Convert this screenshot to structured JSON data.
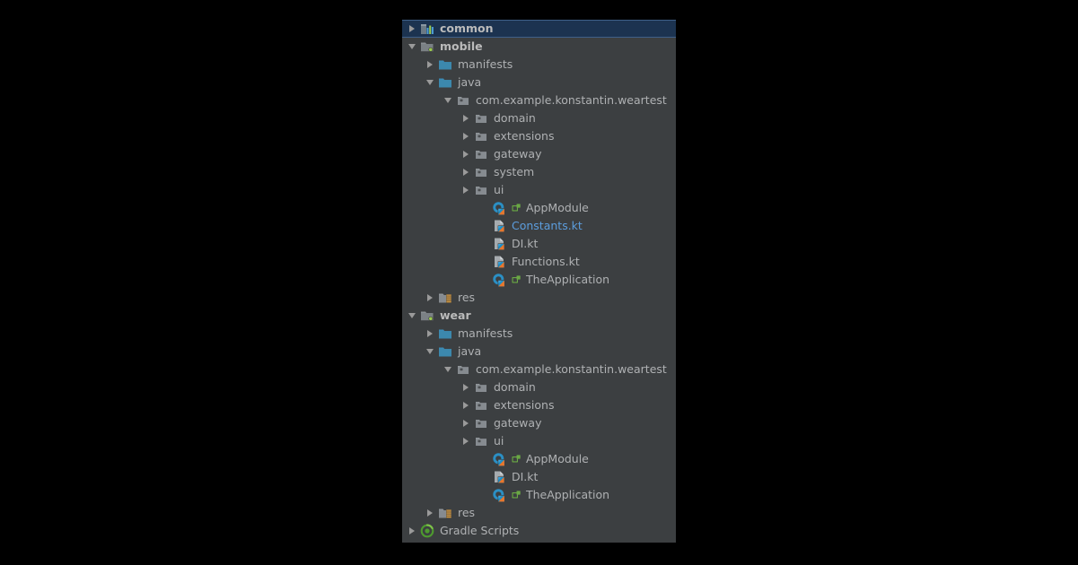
{
  "panel": {
    "name": "project-tree-panel",
    "background": "#3c3f41",
    "selection_color": "#1c3350",
    "selection_border": "#3f6089",
    "text_color": "#afb1b3",
    "link_color": "#5c9ddd"
  },
  "tree": [
    {
      "label": "common",
      "depth": 0,
      "arrow": "collapsed",
      "icon": "module-library-icon",
      "selected": true,
      "style": "bold"
    },
    {
      "label": "mobile",
      "depth": 0,
      "arrow": "expanded",
      "icon": "module-android-icon",
      "selected": false,
      "style": "bold"
    },
    {
      "label": "manifests",
      "depth": 1,
      "arrow": "collapsed",
      "icon": "folder-blue-icon",
      "selected": false,
      "style": "normal"
    },
    {
      "label": "java",
      "depth": 1,
      "arrow": "expanded",
      "icon": "folder-blue-icon",
      "selected": false,
      "style": "normal"
    },
    {
      "label": "com.example.konstantin.weartest",
      "depth": 2,
      "arrow": "expanded",
      "icon": "package-icon",
      "selected": false,
      "style": "normal"
    },
    {
      "label": "domain",
      "depth": 3,
      "arrow": "collapsed",
      "icon": "package-icon",
      "selected": false,
      "style": "normal"
    },
    {
      "label": "extensions",
      "depth": 3,
      "arrow": "collapsed",
      "icon": "package-icon",
      "selected": false,
      "style": "normal"
    },
    {
      "label": "gateway",
      "depth": 3,
      "arrow": "collapsed",
      "icon": "package-icon",
      "selected": false,
      "style": "normal"
    },
    {
      "label": "system",
      "depth": 3,
      "arrow": "collapsed",
      "icon": "package-icon",
      "selected": false,
      "style": "normal"
    },
    {
      "label": "ui",
      "depth": 3,
      "arrow": "collapsed",
      "icon": "package-icon",
      "selected": false,
      "style": "normal"
    },
    {
      "label": "AppModule",
      "depth": 4,
      "arrow": "none",
      "icon": "kotlin-class-icon",
      "badge": "class-badge-icon",
      "selected": false,
      "style": "normal"
    },
    {
      "label": "Constants.kt",
      "depth": 4,
      "arrow": "none",
      "icon": "kotlin-file-icon",
      "selected": false,
      "style": "blue"
    },
    {
      "label": "DI.kt",
      "depth": 4,
      "arrow": "none",
      "icon": "kotlin-file-icon",
      "selected": false,
      "style": "normal"
    },
    {
      "label": "Functions.kt",
      "depth": 4,
      "arrow": "none",
      "icon": "kotlin-file-icon",
      "selected": false,
      "style": "normal"
    },
    {
      "label": "TheApplication",
      "depth": 4,
      "arrow": "none",
      "icon": "kotlin-class-icon",
      "badge": "class-badge-icon",
      "selected": false,
      "style": "normal"
    },
    {
      "label": "res",
      "depth": 1,
      "arrow": "collapsed",
      "icon": "res-folder-icon",
      "selected": false,
      "style": "normal"
    },
    {
      "label": "wear",
      "depth": 0,
      "arrow": "expanded",
      "icon": "module-android-icon",
      "selected": false,
      "style": "bold"
    },
    {
      "label": "manifests",
      "depth": 1,
      "arrow": "collapsed",
      "icon": "folder-blue-icon",
      "selected": false,
      "style": "normal"
    },
    {
      "label": "java",
      "depth": 1,
      "arrow": "expanded",
      "icon": "folder-blue-icon",
      "selected": false,
      "style": "normal"
    },
    {
      "label": "com.example.konstantin.weartest",
      "depth": 2,
      "arrow": "expanded",
      "icon": "package-icon",
      "selected": false,
      "style": "normal"
    },
    {
      "label": "domain",
      "depth": 3,
      "arrow": "collapsed",
      "icon": "package-icon",
      "selected": false,
      "style": "normal"
    },
    {
      "label": "extensions",
      "depth": 3,
      "arrow": "collapsed",
      "icon": "package-icon",
      "selected": false,
      "style": "normal"
    },
    {
      "label": "gateway",
      "depth": 3,
      "arrow": "collapsed",
      "icon": "package-icon",
      "selected": false,
      "style": "normal"
    },
    {
      "label": "ui",
      "depth": 3,
      "arrow": "collapsed",
      "icon": "package-icon",
      "selected": false,
      "style": "normal"
    },
    {
      "label": "AppModule",
      "depth": 4,
      "arrow": "none",
      "icon": "kotlin-class-icon",
      "badge": "class-badge-icon",
      "selected": false,
      "style": "normal"
    },
    {
      "label": "DI.kt",
      "depth": 4,
      "arrow": "none",
      "icon": "kotlin-file-icon",
      "selected": false,
      "style": "normal"
    },
    {
      "label": "TheApplication",
      "depth": 4,
      "arrow": "none",
      "icon": "kotlin-class-icon",
      "badge": "class-badge-icon",
      "selected": false,
      "style": "normal"
    },
    {
      "label": "res",
      "depth": 1,
      "arrow": "collapsed",
      "icon": "res-folder-icon",
      "selected": false,
      "style": "normal"
    },
    {
      "label": "Gradle Scripts",
      "depth": 0,
      "arrow": "collapsed",
      "icon": "gradle-icon",
      "selected": false,
      "style": "normal"
    }
  ]
}
